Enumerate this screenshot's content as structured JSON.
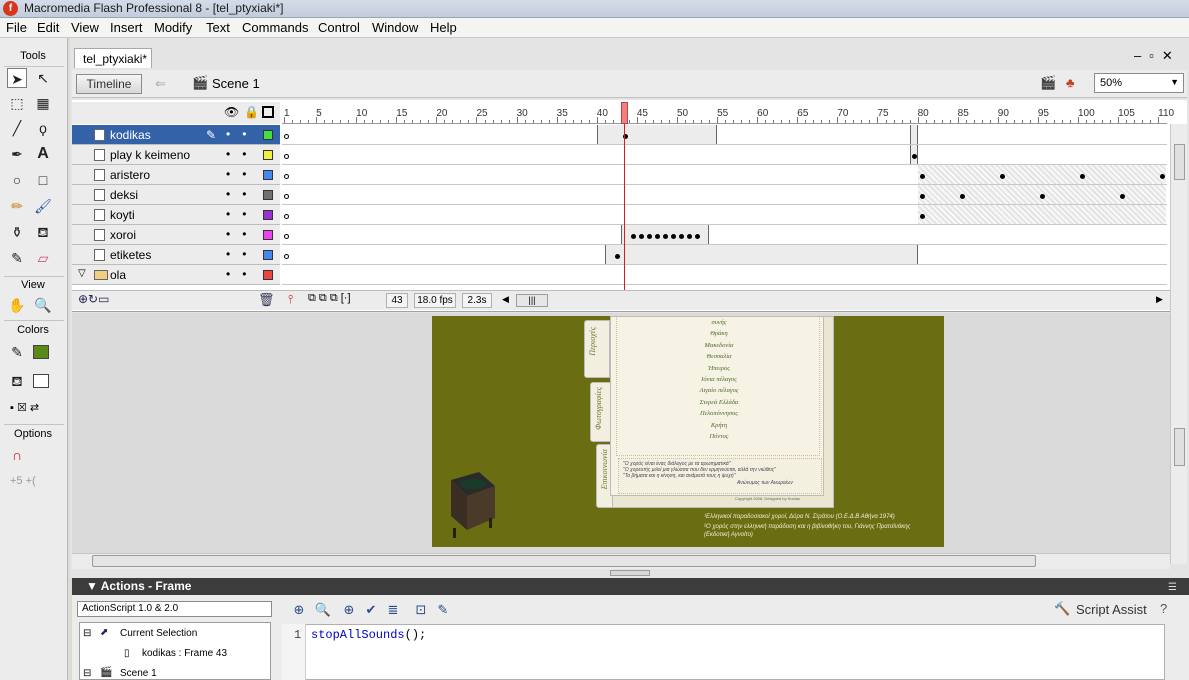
{
  "window": {
    "title": "Macromedia Flash Professional 8 - [tel_ptyxiaki*]"
  },
  "menu": [
    "File",
    "Edit",
    "View",
    "Insert",
    "Modify",
    "Text",
    "Commands",
    "Control",
    "Window",
    "Help"
  ],
  "tools": {
    "header": "Tools",
    "view_header": "View",
    "colors_header": "Colors",
    "options_header": "Options",
    "stroke_color": "#0f0f0f",
    "fill_color": "#5a8a1a"
  },
  "document": {
    "tab": "tel_ptyxiaki*",
    "timeline_button": "Timeline",
    "scene": "Scene 1",
    "zoom": "50%"
  },
  "timeline": {
    "ruler_ticks": [
      "1",
      "5",
      "10",
      "15",
      "20",
      "25",
      "30",
      "35",
      "40",
      "45",
      "50",
      "55",
      "60",
      "65",
      "70",
      "75",
      "80",
      "85",
      "90",
      "95",
      "100",
      "105",
      "110"
    ],
    "layers": [
      {
        "name": "kodikas",
        "color": "#44dd44",
        "selected": true
      },
      {
        "name": "play k keimeno",
        "color": "#f0f040",
        "selected": false
      },
      {
        "name": "aristero",
        "color": "#4488ee",
        "selected": false
      },
      {
        "name": "deksi",
        "color": "#707070",
        "selected": false
      },
      {
        "name": "koyti",
        "color": "#9933cc",
        "selected": false
      },
      {
        "name": "xoroi",
        "color": "#ee44ee",
        "selected": false
      },
      {
        "name": "etiketes",
        "color": "#4488ee",
        "selected": false
      },
      {
        "name": "ola",
        "color": "#ee4444",
        "selected": false
      }
    ],
    "current_frame": "43",
    "fps": "18.0 fps",
    "time": "2.3s"
  },
  "stage": {
    "tabs": [
      "Περιοχές",
      "Φωτογραφίες",
      "Επικοινωνία"
    ],
    "regions": [
      "συνής",
      "Θράκη",
      "Μακεδονία",
      "Θεσσαλία",
      "Ήπειρος",
      "Ιόνια πέλαγος",
      "Αιγαίο πέλαγος",
      "Στερεά Ελλάδα",
      "Πελοπόννησος",
      "Κρήτη",
      "Πόντος"
    ],
    "quote_lines": [
      "\"Ο χορός είναι ένας διάλογος με τα αρωτηματικά\"",
      "\"Ο χορευτής μιλεί μια γλώσσα που δεν ερμηνεύεται, αλλά την νιώθεις\"",
      "\"Το βήματα και η κίνηση, και ανάμεσά τους η ψυχή\""
    ],
    "quote_author": "Ανώνυμος των Ανωρείων",
    "copyright": "Copyright 2008, Designed by Kostas",
    "footnote1": "¹Ελληνικοί παραδοσιακοί χοροί, Δόρα Ν. Στράτου (Ο.Ε.Δ.Β Αθήνα 1974)",
    "footnote2": "²Ο χορός στην ελληνική παράδοση και η βιβλιοθήκη του, Γιάννης Πρατσίνάκης",
    "footnote3": "(Εκδοτική Αγνοίτο)"
  },
  "actions": {
    "title": "Actions - Frame",
    "version": "ActionScript 1.0 & 2.0",
    "tree": [
      "Current Selection",
      "kodikas : Frame 43",
      "Scene 1"
    ],
    "script_assist": "Script Assist",
    "line_number": "1",
    "code_fn": "stopAllSounds",
    "code_rest": "();"
  }
}
